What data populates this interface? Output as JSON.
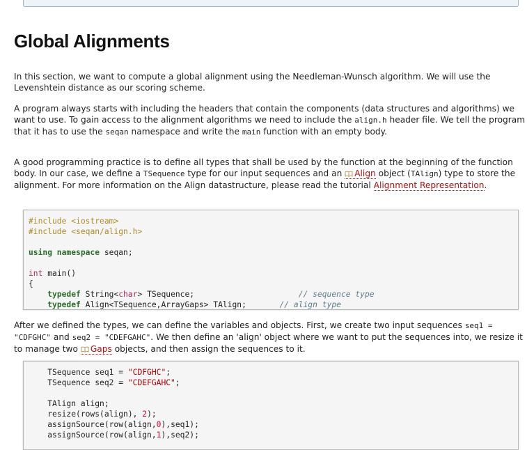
{
  "heading": "Global Alignments",
  "para1": {
    "text": "In this section, we want to compute a global alignment using the Needleman-Wunsch algorithm. We will use the Levenshtein distance as our scoring scheme."
  },
  "para2": {
    "t1": "A program always starts with including the headers that contain the components (data structures and algorithms) we want to use. To gain access to the alignment algorithms we need to include the ",
    "c1": "align.h",
    "t2": " header file. We tell the program that it has to use the ",
    "c2": "seqan",
    "t3": " namespace and write the ",
    "c3": "main",
    "t4": " function with an empty body."
  },
  "para3": {
    "t1": "A good programming practice is to define all types that shall be used by the function at the beginning of the function body. In our case, we define a ",
    "c1": "TSequence",
    "t2": " type for our input sequences and an ",
    "link1": "Align",
    "t3": " object (",
    "c2": "TAlign",
    "t4": ") type to store the alignment. For more information on the Align datastructure, please read the tutorial ",
    "link2": "Alignment Representation",
    "t5": "."
  },
  "para4": {
    "t1": "After we defined the types, we can define the variables and objects. First, we create two input sequences ",
    "c1": "seq1 = \"CDFGHC\"",
    "t2": " and ",
    "c2": "seq2 = \"CDEFGAHC\"",
    "t3": ". We then define an 'align' object where we want to put the sequences into, we resize it to manage two ",
    "link1": "Gaps",
    "t4": " objects, and then assign the sequences to it."
  },
  "code1": {
    "inc1_kw": "#include",
    "inc1_arg": "<iostream>",
    "inc2_kw": "#include",
    "inc2_arg": "<seqan/align.h>",
    "using_kw": "using namespace",
    "using_ns": "seqan;",
    "int_kw": "int",
    "main_sig": "main()",
    "brace": "{",
    "typedef1_kw": "typedef",
    "typedef1_a": "String<",
    "typedef1_t": "char",
    "typedef1_b": "> TSequence;",
    "comment1": "// sequence type",
    "typedef2_kw": "typedef",
    "typedef2_b": "Align<TSequence,ArrayGaps> TAlign;",
    "comment2": "// align type"
  },
  "code2": {
    "l1_a": "TSequence seq1 = ",
    "l1_s": "\"CDFGHC\"",
    "l1_e": ";",
    "l2_a": "TSequence seq2 = ",
    "l2_s": "\"CDEFGAHC\"",
    "l2_e": ";",
    "l3": "TAlign align;",
    "l4_a": "resize(rows(align), ",
    "l4_n": "2",
    "l4_e": ");",
    "l5_a": "assignSource(row(align,",
    "l5_n": "0",
    "l5_e": "),seq1);",
    "l6_a": "assignSource(row(align,",
    "l6_n": "1",
    "l6_e": "),seq2);"
  }
}
